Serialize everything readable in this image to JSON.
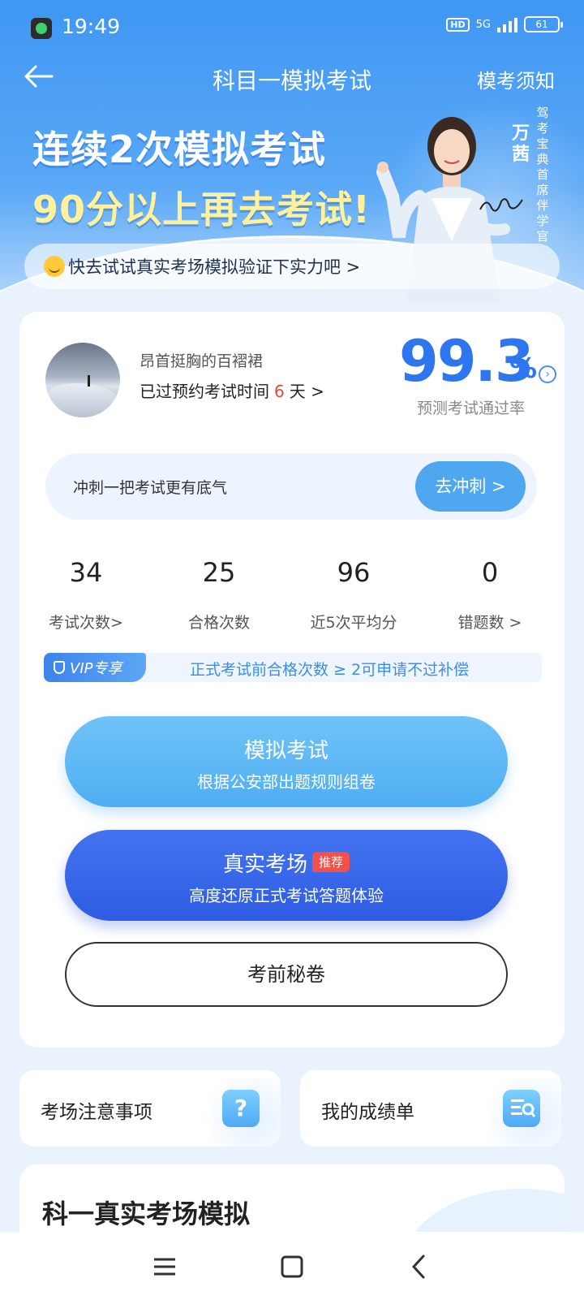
{
  "status_bar": {
    "time": "19:49",
    "hd": "HD",
    "network": "5G",
    "battery": "61"
  },
  "nav": {
    "title": "科目一模拟考试",
    "right_link": "模考须知"
  },
  "banner": {
    "slogan_line1": "连续2次模拟考试",
    "slogan_line2": "90分以上再去考试!",
    "tip": "快去试试真实考场模拟验证下实力吧 >",
    "person_name": "万茜",
    "person_role": "驾考宝典首席伴学官"
  },
  "profile": {
    "username": "昂首挺胸的百褶裙",
    "days_prefix": "已过预约考试时间",
    "days_value": "6",
    "days_suffix": "天 >",
    "pass_rate": "99.3",
    "pass_rate_unit": "%",
    "pass_rate_label": "预测考试通过率"
  },
  "sprint": {
    "text": "冲刺一把考试更有底气",
    "button": "去冲刺 >"
  },
  "stats": [
    {
      "value": "34",
      "label": "考试次数>"
    },
    {
      "value": "25",
      "label": "合格次数"
    },
    {
      "value": "96",
      "label": "近5次平均分"
    },
    {
      "value": "0",
      "label": "错题数 >"
    }
  ],
  "vip": {
    "tag": "VIP专享",
    "text": "正式考试前合格次数 ≥ 2可申请不过补偿"
  },
  "buttons": {
    "mock_title": "模拟考试",
    "mock_sub": "根据公安部出题规则组卷",
    "real_title": "真实考场",
    "real_badge": "推荐",
    "real_sub": "高度还原正式考试答题体验",
    "secret": "考前秘卷"
  },
  "quick_links": [
    {
      "label": "考场注意事项",
      "icon": "question-icon"
    },
    {
      "label": "我的成绩单",
      "icon": "report-icon"
    }
  ],
  "section": {
    "title": "科一真实考场模拟"
  },
  "colors": {
    "primary": "#2e76f0",
    "accent_light": "#4fa7f0",
    "warning": "#e8463a",
    "badge": "#f4504a"
  }
}
